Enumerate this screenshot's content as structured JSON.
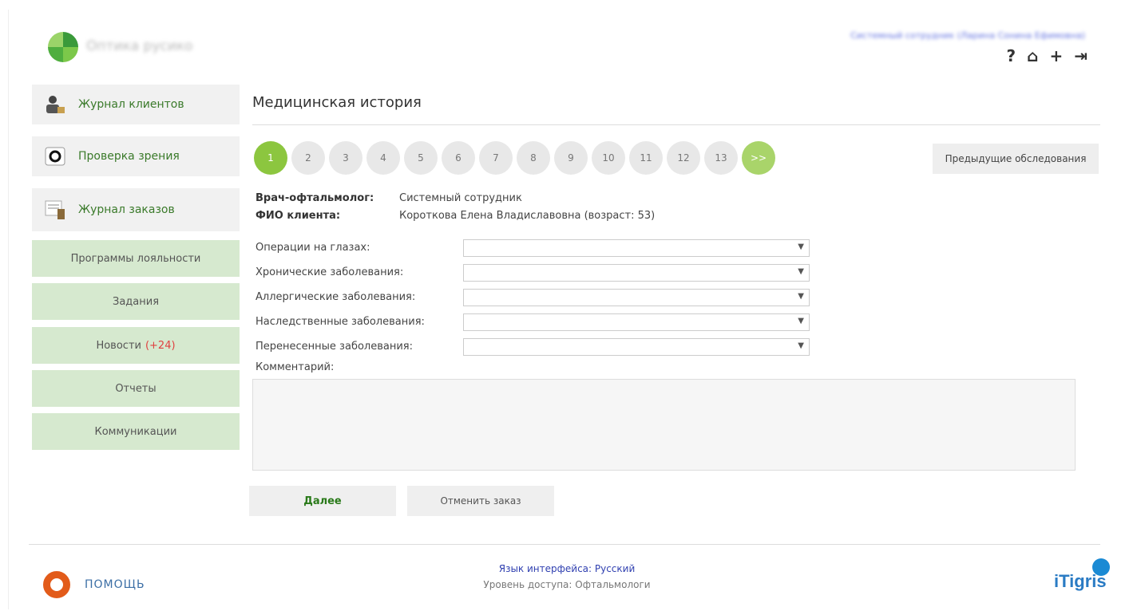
{
  "header": {
    "brand": "Оптика русико",
    "user_line": "Системный сотрудник (Ларина Сонина Ефимовна)",
    "icons": [
      {
        "name": "help-icon",
        "glyph": "?"
      },
      {
        "name": "home-icon",
        "glyph": "⌂"
      },
      {
        "name": "add-icon",
        "glyph": "+"
      },
      {
        "name": "logout-icon",
        "glyph": "⇥"
      }
    ]
  },
  "sidebar": {
    "big_items": [
      {
        "label": "Журнал клиентов",
        "icon": "client-journal-icon"
      },
      {
        "label": "Проверка зрения",
        "icon": "eye-exam-icon"
      },
      {
        "label": "Журнал заказов",
        "icon": "order-journal-icon"
      }
    ],
    "items": [
      {
        "label": "Программы лояльности"
      },
      {
        "label": "Задания"
      },
      {
        "label": "Новости",
        "count": "(+24)"
      },
      {
        "label": "Отчеты"
      },
      {
        "label": "Коммуникации"
      }
    ]
  },
  "main": {
    "title": "Медицинская история",
    "steps": [
      "1",
      "2",
      "3",
      "4",
      "5",
      "6",
      "7",
      "8",
      "9",
      "10",
      "11",
      "12",
      "13",
      ">>"
    ],
    "active_step": "1",
    "prev_exams_label": "Предыдущие обследования",
    "doctor_label": "Врач-офтальмолог:",
    "doctor_value": "Системный сотрудник",
    "client_label": "ФИО клиента:",
    "client_value": "Короткова Елена Владиславовна (возраст: 53)",
    "fields": [
      {
        "label": "Операции на глазах:",
        "value": ""
      },
      {
        "label": "Хронические заболевания:",
        "value": ""
      },
      {
        "label": "Аллергические заболевания:",
        "value": ""
      },
      {
        "label": "Наследственные заболевания:",
        "value": ""
      },
      {
        "label": "Перенесенные заболевания:",
        "value": ""
      }
    ],
    "comment_label": "Комментарий:",
    "comment_value": "",
    "next_button": "Далее",
    "cancel_button": "Отменить заказ"
  },
  "footer": {
    "help_label": "ПОМОЩЬ",
    "language": "Язык интерфейса: Русский",
    "access": "Уровень доступа: Офтальмологи",
    "logo": "iTigris"
  },
  "colors": {
    "accent_green": "#8cc63f",
    "menu_green": "#d6e9cf",
    "link_green": "#3a7a2a",
    "news_red": "#e04040"
  }
}
